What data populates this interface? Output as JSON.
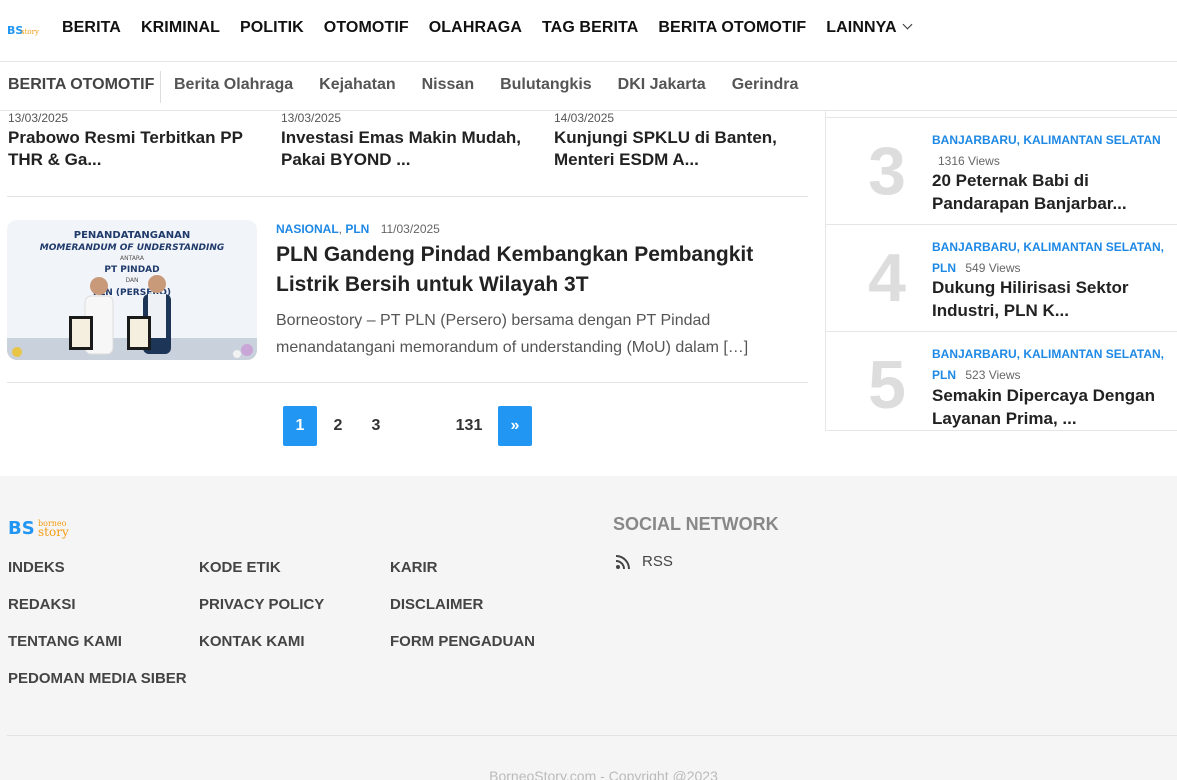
{
  "brand": {
    "logo_text": "BS story",
    "footer_logo_text": "borneo story"
  },
  "nav": {
    "items": [
      "BERITA",
      "KRIMINAL",
      "POLITIK",
      "OTOMOTIF",
      "OLAHRAGA",
      "TAG BERITA",
      "BERITA OTOMOTIF",
      "LAINNYA"
    ]
  },
  "subnav": {
    "first": "BERITA OTOMOTIF",
    "items": [
      "Berita Olahraga",
      "Kejahatan",
      "Nissan",
      "Bulutangkis",
      "DKI Jakarta",
      "Gerindra"
    ]
  },
  "strip": [
    {
      "date": "13/03/2025",
      "title": "Prabowo Resmi Terbitkan PP THR & Ga..."
    },
    {
      "date": "13/03/2025",
      "title": "Investasi Emas Makin Mudah, Pakai BYOND ..."
    },
    {
      "date": "14/03/2025",
      "title": "Kunjungi SPKLU di Banten, Menteri ESDM A..."
    }
  ],
  "feature": {
    "cat1": "NASIONAL",
    "cat2": "PLN",
    "date": "11/03/2025",
    "title": "PLN Gandeng Pindad Kembangkan Pembangkit Listrik Bersih untuk Wilayah 3T",
    "excerpt": "Borneostory – PT PLN (Persero) bersama dengan PT Pindad menandatangani memorandum of understanding (MoU) dalam […]",
    "image_text": {
      "line1": "PENANDATANGANAN",
      "line2": "MOMERANDUM OF UNDERSTANDING",
      "line3": "ANTARA",
      "line4": "PT PINDAD",
      "line5": "DAN",
      "line6": "PLN (PERSERO)"
    }
  },
  "pagination": {
    "current": "1",
    "p2": "2",
    "p3": "3",
    "last": "131",
    "next": "»"
  },
  "popular": [
    {
      "rank": "3",
      "cats": "BANJARBARU, KALIMANTAN SELATAN",
      "views": "1316 Views",
      "title": "20 Peternak Babi di Pandarapan Banjarbar..."
    },
    {
      "rank": "4",
      "cats": "BANJARBARU, KALIMANTAN SELATAN, PLN",
      "views": "549 Views",
      "title": "Dukung Hilirisasi Sektor Industri, PLN K..."
    },
    {
      "rank": "5",
      "cats": "BANJARBARU, KALIMANTAN SELATAN, PLN",
      "views": "523 Views",
      "title": "Semakin Dipercaya Dengan Layanan Prima, ..."
    }
  ],
  "footer": {
    "links": [
      "INDEKS",
      "KODE ETIK",
      "KARIR",
      "REDAKSI",
      "PRIVACY POLICY",
      "DISCLAIMER",
      "TENTANG KAMI",
      "KONTAK KAMI",
      "FORM PENGADUAN",
      "PEDOMAN MEDIA SIBER"
    ],
    "social_title": "SOCIAL NETWORK",
    "rss_label": "RSS",
    "copyright": "BorneoStory.com - Copyright @2023"
  },
  "colors": {
    "accent": "#2196f3",
    "category": "#1e88e5",
    "footer_bg": "#f5f5f5"
  }
}
